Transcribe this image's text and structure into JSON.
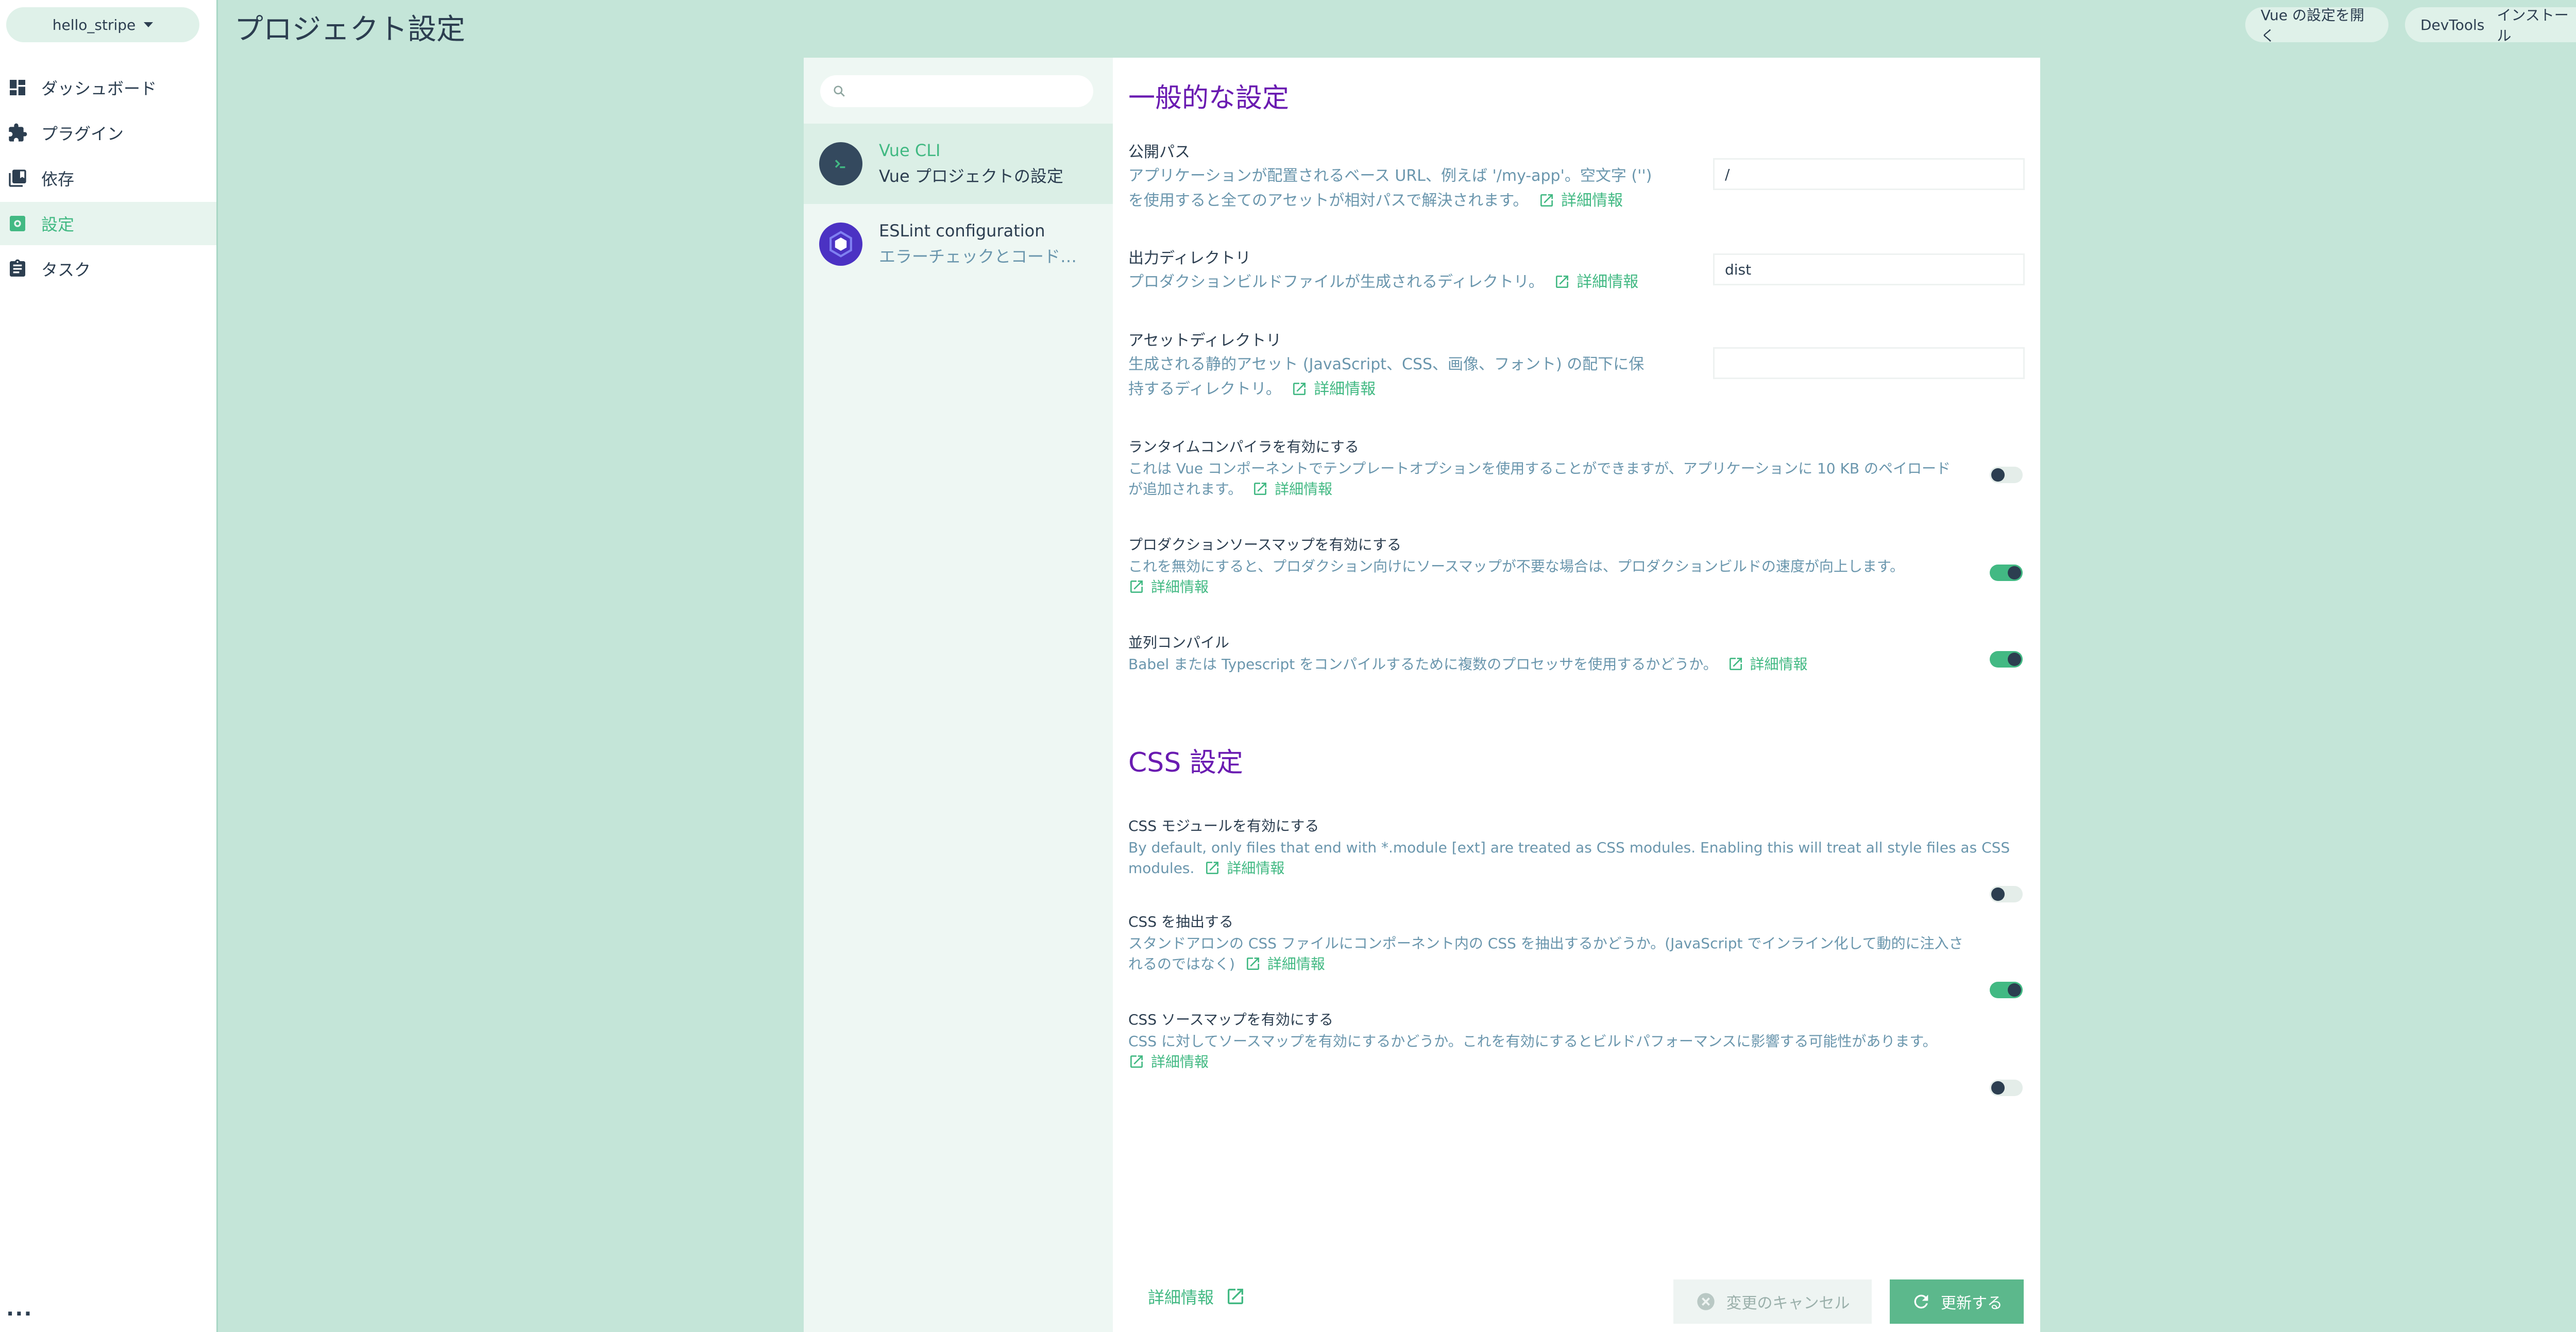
{
  "sidebar": {
    "project_name": "hello_stripe",
    "items": [
      {
        "label": "ダッシュボード",
        "icon": "dashboard-icon"
      },
      {
        "label": "プラグイン",
        "icon": "puzzle-icon"
      },
      {
        "label": "依存",
        "icon": "library-icon"
      },
      {
        "label": "設定",
        "icon": "settings-icon",
        "active": true
      },
      {
        "label": "タスク",
        "icon": "clipboard-icon"
      }
    ],
    "more": "..."
  },
  "header": {
    "title": "プロジェクト設定",
    "open_vue_config": "Vue の設定を開く",
    "devtools_label": "DevTools",
    "install_label": "インストール"
  },
  "plugins": {
    "search_placeholder": "",
    "items": [
      {
        "name": "Vue CLI",
        "description": "Vue プロジェクトの設定",
        "active": true
      },
      {
        "name": "ESLint configuration",
        "description": "エラーチェックとコード品質の設定"
      }
    ]
  },
  "general": {
    "title": "一般的な設定",
    "public_path": {
      "label": "公開パス",
      "desc1": "アプリケーションが配置されるベース URL、例えば '/my-app'。空文字 ('')",
      "desc2": "を使用すると全てのアセットが相対パスで解決されます。",
      "value": "/"
    },
    "output_dir": {
      "label": "出力ディレクトリ",
      "desc": "プロダクションビルドファイルが生成されるディレクトリ。",
      "value": "dist"
    },
    "assets_dir": {
      "label": "アセットディレクトリ",
      "desc1": "生成される静的アセット (JavaScript、CSS、画像、フォント) の配下に保",
      "desc2": "持するディレクトリ。",
      "value": ""
    },
    "runtime_compiler": {
      "label": "ランタイムコンパイラを有効にする",
      "desc1": "これは Vue コンポーネントでテンプレートオプションを使用することができますが、アプリケーションに 10 KB のペイロード",
      "desc2": "が追加されます。",
      "enabled": false
    },
    "prod_source_map": {
      "label": "プロダクションソースマップを有効にする",
      "desc": "これを無効にすると、プロダクション向けにソースマップが不要な場合は、プロダクションビルドの速度が向上します。",
      "enabled": true
    },
    "parallel": {
      "label": "並列コンパイル",
      "desc": "Babel または Typescript をコンパイルするために複数のプロセッサを使用するかどうか。",
      "enabled": true
    }
  },
  "css": {
    "title": "CSS 設定",
    "modules": {
      "label": "CSS モジュールを有効にする",
      "desc1": "By default, only files that end with *.module [ext] are treated as CSS modules. Enabling this will treat all style files as CSS",
      "desc2": "modules.",
      "enabled": false
    },
    "extract": {
      "label": "CSS を抽出する",
      "desc1": "スタンドアロンの CSS ファイルにコンポーネント内の CSS を抽出するかどうか。(JavaScript でインライン化して動的に注入さ",
      "desc2": "れるのではなく)",
      "enabled": true
    },
    "source_map": {
      "label": "CSS ソースマップを有効にする",
      "desc": "CSS に対してソースマップを有効にするかどうか。これを有効にするとビルドパフォーマンスに影響する可能性があります。",
      "enabled": false
    }
  },
  "more_info": "詳細情報",
  "footer": {
    "more_info": "詳細情報",
    "cancel": "変更のキャンセル",
    "save": "更新する"
  },
  "colors": {
    "accent": "#42b983",
    "heading": "#6a1bb1",
    "background": "#c4e5d8",
    "text": "#2c3e50",
    "muted": "#6a96ad"
  }
}
